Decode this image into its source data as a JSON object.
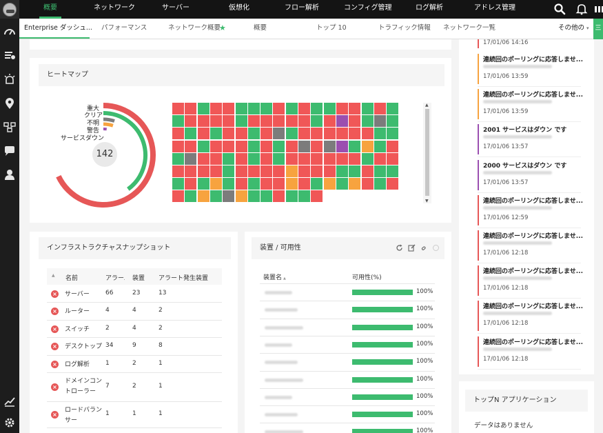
{
  "topnav": {
    "tabs": [
      "概要",
      "ネットワーク",
      "サーバー",
      "仮想化",
      "フロー解析",
      "コンフィグ管理",
      "ログ解析",
      "アドレス管理"
    ],
    "icons": [
      "search-icon",
      "bell-icon",
      "grid-icon"
    ]
  },
  "sidebar": {
    "icons": [
      "dashboard-icon",
      "inventory-icon",
      "alarm-icon",
      "map-icon",
      "network-icon",
      "chat-icon",
      "user-icon",
      "reports-icon",
      "settings-icon"
    ]
  },
  "subnav": {
    "tabs": [
      "Enterprise ダッシュ...",
      "パフォーマンス",
      "ネットワーク概要",
      "概要",
      "トップ 10",
      "トラフィック情報",
      "ネットワーク一覧"
    ],
    "star": "★",
    "more": "その他の",
    "more_caret": "▾",
    "green_tab": "三"
  },
  "heatmap": {
    "title": "ヒートマップ",
    "center_value": "142",
    "legend": [
      "重大",
      "クリア",
      "不明",
      "警告",
      "サービスダウン"
    ],
    "legend_colors": [
      "#e65757",
      "#3dbb6f",
      "#7c7c7c",
      "#f7a33f",
      "#9b4fb0"
    ],
    "ring_fractions": {
      "critical": 0.68,
      "clear": 0.4,
      "unknown": 0.05,
      "warning": 0.05,
      "service_down": 0.02
    },
    "colors": {
      "R": "#f05757",
      "G": "#3dbb6f",
      "Y": "#f7a33f",
      "X": "#7c7c7c",
      "P": "#9b4fb0"
    },
    "rows": [
      "RRGRRGGGRGRGGRRGRG",
      "GRRRRGRRRRRGRPRGXG",
      "RGRGRRGRXGRRRRRRGG",
      "RRGRRRGRGRXRXPGYGR",
      "GXRRGRGRGRRRRRRGRR",
      "RRRRGRRRRYRRRGGRGG",
      "GRGYGRGRRYRGYGYRGR",
      "RGYGXYGGRGGR"
    ]
  },
  "infra": {
    "title": "インフラストラクチャスナップショット",
    "sort_icon": "▲",
    "headers": [
      "名前",
      "アラーム",
      "装置",
      "アラート発生装置"
    ],
    "rows": [
      {
        "name": "サーバー",
        "alarms": "66",
        "devices": "23",
        "alerted": "13"
      },
      {
        "name": "ルーター",
        "alarms": "4",
        "devices": "4",
        "alerted": "2"
      },
      {
        "name": "スイッチ",
        "alarms": "2",
        "devices": "4",
        "alerted": "2"
      },
      {
        "name": "デスクトップ",
        "alarms": "34",
        "devices": "9",
        "alerted": "8"
      },
      {
        "name": "ログ解析",
        "alarms": "1",
        "devices": "2",
        "alerted": "1"
      },
      {
        "name": "ドメインコントローラー",
        "alarms": "7",
        "devices": "2",
        "alerted": "1"
      },
      {
        "name": "ロードバランサー",
        "alarms": "1",
        "devices": "1",
        "alerted": "1"
      },
      {
        "name": "…",
        "alarms": "",
        "devices": "",
        "alerted": ""
      }
    ]
  },
  "availability": {
    "title": "装置 / 可用性",
    "headers": [
      "装置名",
      "可用性(%)"
    ],
    "sort_icon": "▲",
    "rows": [
      {
        "pct": "100%",
        "value": 1.0
      },
      {
        "pct": "100%",
        "value": 1.0
      },
      {
        "pct": "100%",
        "value": 1.0
      },
      {
        "pct": "100%",
        "value": 1.0
      },
      {
        "pct": "100%",
        "value": 1.0
      },
      {
        "pct": "100%",
        "value": 1.0
      },
      {
        "pct": "100%",
        "value": 1.0
      },
      {
        "pct": "100%",
        "value": 1.0
      },
      {
        "pct": "100%",
        "value": 1.0
      }
    ],
    "tools": [
      "refresh-icon",
      "edit-icon",
      "link-icon",
      "close-icon"
    ]
  },
  "alarms": {
    "first_time": "17/01/06 14:16",
    "items": [
      {
        "title": "連続回のポーリングに応答しませ...",
        "time": "17/01/06 13:59",
        "color": "#f7a33f"
      },
      {
        "title": "連続回のポーリングに応答しませ...",
        "time": "17/01/06 13:59",
        "color": "#f7a33f"
      },
      {
        "title": "2001 サービスはダウン です",
        "time": "17/01/06 13:57",
        "color": "#9b4fb0"
      },
      {
        "title": "2000 サービスはダウン です",
        "time": "17/01/06 13:57",
        "color": "#9b4fb0"
      },
      {
        "title": "連続回のポーリングに応答しませ...",
        "time": "17/01/06 12:59",
        "color": "#e65757"
      },
      {
        "title": "連続回のポーリングに応答しませ...",
        "time": "17/01/06 12:18",
        "color": "#e65757"
      },
      {
        "title": "連続回のポーリングに応答しませ...",
        "time": "17/01/06 12:18",
        "color": "#e65757"
      },
      {
        "title": "連続回のポーリングに応答しませ...",
        "time": "17/01/06 12:18",
        "color": "#e65757"
      },
      {
        "title": "連続回のポーリングに応答しませ...",
        "time": "17/01/06 12:18",
        "color": "#e65757"
      }
    ]
  },
  "topn": {
    "title": "トップN アプリケーション",
    "empty": "データはありません"
  }
}
